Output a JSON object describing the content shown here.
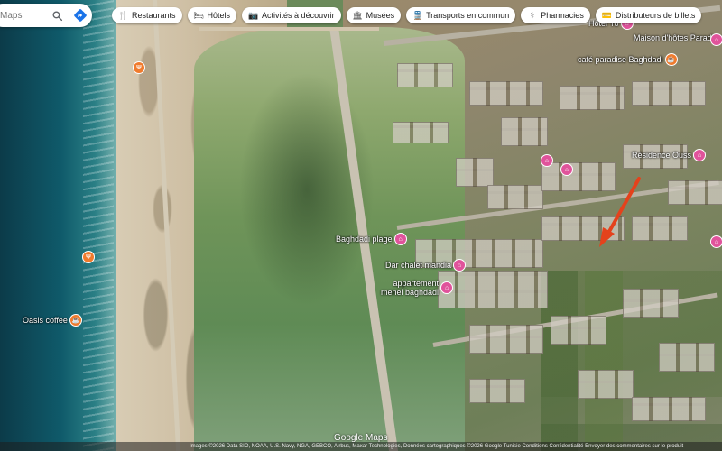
{
  "search": {
    "placeholder": "Maps"
  },
  "chips": [
    {
      "label": "Restaurants",
      "icon": "fork-knife-icon"
    },
    {
      "label": "Hôtels",
      "icon": "bed-icon"
    },
    {
      "label": "Activités à découvrir",
      "icon": "camera-icon"
    },
    {
      "label": "Musées",
      "icon": "museum-icon"
    },
    {
      "label": "Transports en commun",
      "icon": "train-icon"
    },
    {
      "label": "Pharmacies",
      "icon": "pharmacy-icon"
    },
    {
      "label": "Distributeurs de billets",
      "icon": "atm-icon"
    }
  ],
  "pois": [
    {
      "label": "Baghdadi plage",
      "color": "#e0539b"
    },
    {
      "label": "Dar chalet mandia",
      "color": "#e0539b"
    },
    {
      "label": "appartement\nmenel baghdadi",
      "color": "#e0539b"
    },
    {
      "label": "Oasis coffee",
      "color": "#f07b2d"
    },
    {
      "label": "Maison d'hôtes Paradise",
      "color": "#e0539b"
    },
    {
      "label": "café paradise Baghdadi",
      "color": "#f07b2d"
    },
    {
      "label": "Résidence Ouss",
      "color": "#e0539b"
    },
    {
      "label": "Hôtel Yo",
      "color": "#e0539b"
    }
  ],
  "footer": {
    "logo": "Google Maps",
    "attribution": "Images ©2026 Data SIO, NOAA, U.S. Navy, NGA, GEBCO, Airbus, Maxar Technologies, Données cartographiques ©2026 Google    Tunisie    Conditions    Confidentialité    Envoyer des commentaires sur le produit"
  },
  "colors": {
    "annotation_arrow": "#e4421c",
    "directions_button": "#1a73e8"
  }
}
